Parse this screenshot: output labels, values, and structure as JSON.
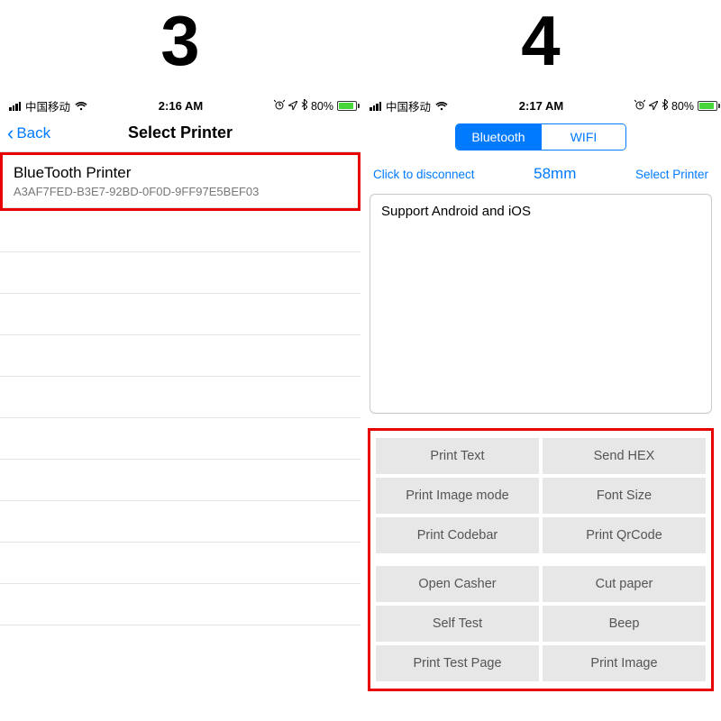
{
  "labels": {
    "num3": "3",
    "num4": "4"
  },
  "screen3": {
    "statusbar": {
      "carrier": "中国移动",
      "time": "2:16 AM",
      "battery": "80%"
    },
    "nav": {
      "back": "Back",
      "title": "Select Printer"
    },
    "device": {
      "name": "BlueTooth Printer",
      "uuid": "A3AF7FED-B3E7-92BD-0F0D-9FF97E5BEF03"
    }
  },
  "screen4": {
    "statusbar": {
      "carrier": "中国移动",
      "time": "2:17 AM",
      "battery": "80%"
    },
    "seg": {
      "bt": "Bluetooth",
      "wifi": "WIFI"
    },
    "links": {
      "disconnect": "Click to disconnect",
      "size": "58mm",
      "select": "Select Printer"
    },
    "textarea": "Support Android and iOS",
    "buttons": [
      "Print Text",
      "Send HEX",
      "Print Image mode",
      "Font Size",
      "Print Codebar",
      "Print QrCode",
      "Open Casher",
      "Cut paper",
      "Self Test",
      "Beep",
      "Print Test Page",
      "Print Image"
    ]
  }
}
